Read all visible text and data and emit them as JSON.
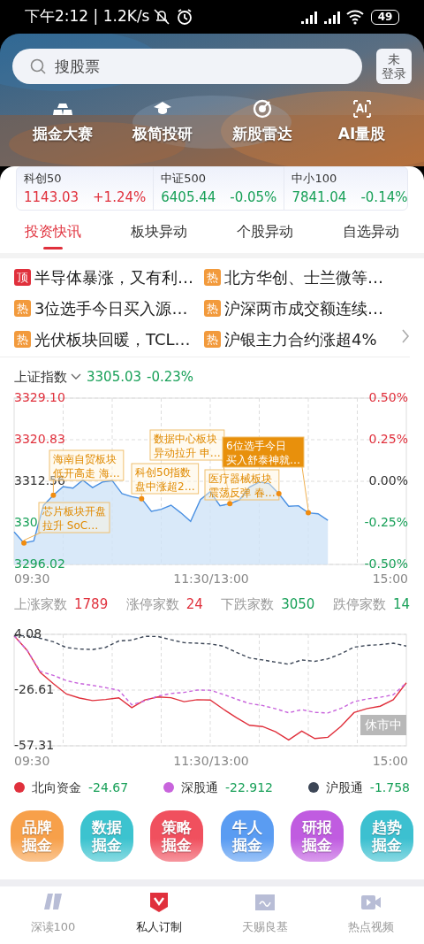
{
  "status_bar": {
    "time": "下午2:12 | 1.2K/s",
    "battery": "49"
  },
  "header": {
    "search": {
      "placeholder": "搜股票"
    },
    "login_button": [
      "未",
      "登录"
    ],
    "shortcuts": [
      {
        "label": "掘金大赛"
      },
      {
        "label": "极简投研"
      },
      {
        "label": "新股雷达"
      },
      {
        "label": "AI量股"
      }
    ]
  },
  "indices": [
    {
      "name": "科创50",
      "price": "1143.03",
      "change": "+1.24%",
      "rising": true
    },
    {
      "name": "中证500",
      "price": "6405.44",
      "change": "-0.05%",
      "rising": false
    },
    {
      "name": "中小100",
      "price": "7841.04",
      "change": "-0.14%",
      "rising": false
    }
  ],
  "tabs": [
    {
      "label": "投资快讯",
      "selected": true
    },
    {
      "label": "板块异动",
      "selected": false
    },
    {
      "label": "个股异动",
      "selected": false
    },
    {
      "label": "自选异动",
      "selected": false
    }
  ],
  "news": [
    {
      "kind": "top",
      "tag": "顶",
      "title": "半导体暴涨，又有利…"
    },
    {
      "kind": "hot",
      "tag": "热",
      "title": "北方华创、士兰微等…"
    },
    {
      "kind": "hot",
      "tag": "热",
      "title": "3位选手今日买入源…"
    },
    {
      "kind": "hot",
      "tag": "热",
      "title": "沪深两市成交额连续…"
    },
    {
      "kind": "hot",
      "tag": "热",
      "title": "光伏板块回暖，TCL…"
    },
    {
      "kind": "hot",
      "tag": "热",
      "title": "沪银主力合约涨超4%"
    }
  ],
  "index_chart": {
    "name": "上证指数",
    "price": "3305.03",
    "change": "-0.23%",
    "rising": false,
    "covered_axis_label": "330",
    "time_labels": [
      "09:30",
      "11:30/13:00",
      "15:00"
    ],
    "callouts": [
      {
        "text": "数据中心板块异动拉升 申…",
        "highlighted": false
      },
      {
        "text": "6位选手今日买入舒泰神就…",
        "highlighted": true
      },
      {
        "text": "海南自贸板块低开高走 海…",
        "highlighted": false
      },
      {
        "text": "科创50指数盘中涨超2…",
        "highlighted": false
      },
      {
        "text": "医疗器械板块震荡反弹 春…",
        "highlighted": false
      },
      {
        "text": "芯片板块开盘拉升 SoC…",
        "highlighted": false
      }
    ],
    "chart_data": {
      "type": "area",
      "grid": true,
      "values": [
        3302.5,
        3300.3,
        3300.7,
        3307.8,
        3309.8,
        3311.5,
        3311.2,
        3312.8,
        3311.3,
        3312.4,
        3312.7,
        3310.1,
        3309.5,
        3309.1,
        3306.6,
        3307.0,
        3307.8,
        3306.3,
        3304.6,
        3308.9,
        3310.5,
        3307.7,
        3308.1,
        3308.9,
        3311.4,
        3312.4,
        3312.1,
        3310.1,
        3307.6,
        3307.7,
        3306.3,
        3306.1,
        3304.8,
        null,
        null,
        null,
        null,
        null,
        null,
        null,
        null
      ],
      "ylim": [
        3296.02,
        3329.1
      ],
      "yticks": [
        {
          "value": 3329.1,
          "label": "3329.10"
        },
        {
          "value": 3320.83,
          "label": "3320.83"
        },
        {
          "value": 3312.56,
          "label": "3312.56"
        },
        {
          "value": 3296.02,
          "label": "3296.02"
        }
      ],
      "y2lim": [
        -0.5,
        0.5
      ],
      "y2ticks": [
        {
          "value": 0.5,
          "label": "0.50%"
        },
        {
          "value": 0.25,
          "label": "0.25%"
        },
        {
          "value": 0,
          "label": "0.00%"
        },
        {
          "value": -0.25,
          "label": "-0.25%"
        },
        {
          "value": -0.5,
          "label": "-0.50%"
        }
      ]
    }
  },
  "market_stats": [
    {
      "label": "上涨家数",
      "value": "1789",
      "rising": true
    },
    {
      "label": "涨停家数",
      "value": "24",
      "rising": true
    },
    {
      "label": "下跌家数",
      "value": "3050",
      "rising": false
    },
    {
      "label": "跌停家数",
      "value": "14",
      "rising": false
    }
  ],
  "flow_chart": {
    "status_badge": "休市中",
    "time_labels": [
      "09:30",
      "11:30/13:00",
      "15:00"
    ],
    "legend_values": [
      "-24.67",
      "-22.912",
      "-1.758"
    ],
    "chart_data": {
      "type": "line",
      "grid": true,
      "series": [
        {
          "name": "北向资金",
          "color": "#e0303c",
          "line_style": "solid",
          "values": [
            3.3,
            -4.8,
            -16.9,
            -23.1,
            -28.8,
            -31.0,
            -32.4,
            -31.8,
            -30.9,
            -36.3,
            -32.0,
            -30.4,
            -30.8,
            -33.0,
            -31.9,
            -32.1,
            -37.1,
            -41.8,
            -46.0,
            -46.7,
            -49.6,
            -54.1,
            -49.2,
            -53.3,
            -52.6,
            -46.6,
            -39.0,
            -36.8,
            -35.5,
            -31.9,
            -22.6
          ]
        },
        {
          "name": "深股通",
          "color": "#c864dc",
          "line_style": "dashed",
          "values": [
            3.3,
            -4.8,
            -16.3,
            -18.5,
            -21.4,
            -23.0,
            -24.0,
            -25.3,
            -26.7,
            -34.7,
            -32.6,
            -29.9,
            -28.5,
            -27.9,
            -26.6,
            -26.7,
            -29.0,
            -31.6,
            -34.0,
            -35.1,
            -36.9,
            -39.1,
            -37.4,
            -38.9,
            -39.2,
            -36.7,
            -33.0,
            -31.5,
            -30.6,
            -29.2,
            -22.6
          ]
        },
        {
          "name": "沪股通",
          "color": "#3c4656",
          "line_style": "dashed",
          "values": [
            3.3,
            3.3,
            1.9,
            0.0,
            -3.2,
            -4.0,
            -4.3,
            -3.1,
            0.4,
            0.9,
            3.0,
            2.9,
            1.1,
            -0.5,
            -0.8,
            -1.2,
            -2.4,
            -5.8,
            -8.9,
            -10.0,
            -11.2,
            -12.4,
            -10.0,
            -10.8,
            -9.4,
            -6.6,
            -3.0,
            -2.0,
            -1.6,
            -0.8,
            -2.4
          ]
        }
      ],
      "ylim": [
        -57.31,
        4.08
      ],
      "yticks": [
        {
          "value": 4.08,
          "label": "4.08"
        },
        {
          "value": -26.61,
          "label": "-26.61"
        },
        {
          "value": -57.31,
          "label": "-57.31"
        }
      ]
    }
  },
  "features": [
    {
      "label": "品牌掘金",
      "color": "#f7a04a"
    },
    {
      "label": "数据掘金",
      "color": "#3cc3cf"
    },
    {
      "label": "策略掘金",
      "color": "#f0505e"
    },
    {
      "label": "牛人掘金",
      "color": "#5a9cf2"
    },
    {
      "label": "研报掘金",
      "color": "#c05ce0"
    },
    {
      "label": "趋势掘金",
      "color": "#3cc0d0"
    }
  ],
  "bottom_nav": [
    {
      "label": "深读100",
      "selected": false
    },
    {
      "label": "私人订制",
      "selected": true
    },
    {
      "label": "天赐良基",
      "selected": false
    },
    {
      "label": "热点视频",
      "selected": false
    }
  ]
}
